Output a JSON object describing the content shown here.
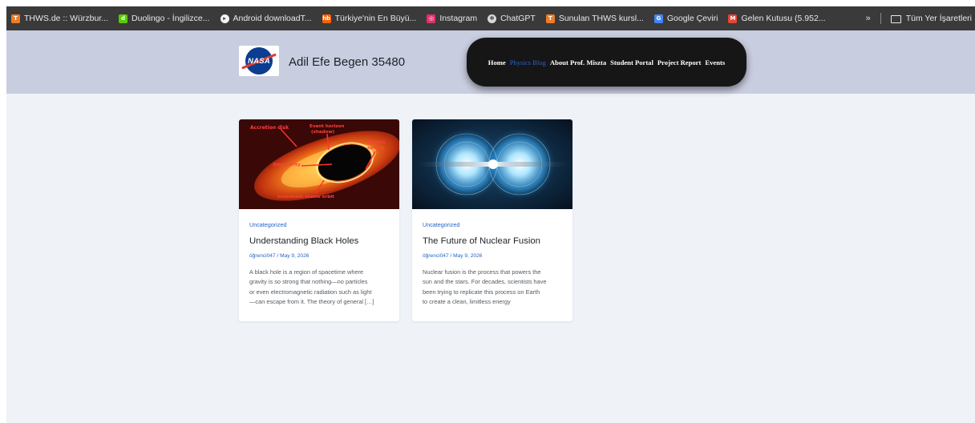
{
  "bookmarks": [
    {
      "label": "THWS.de :: Würzbur...",
      "icon": "thws-icon",
      "color": "#f07c24",
      "glyph": "T"
    },
    {
      "label": "Duolingo - İngilizce...",
      "icon": "duolingo-icon",
      "color": "#58cc02",
      "glyph": "d"
    },
    {
      "label": "Android downloadT...",
      "icon": "download-icon",
      "color": "#f2f2f2",
      "glyph": "▸"
    },
    {
      "label": "Türkiye'nin En Büyü...",
      "icon": "hb-icon",
      "color": "#ff6000",
      "glyph": "hb"
    },
    {
      "label": "Instagram",
      "icon": "instagram-icon",
      "color": "#e1306c",
      "glyph": "◎"
    },
    {
      "label": "ChatGPT",
      "icon": "chatgpt-icon",
      "color": "#d9d9d9",
      "glyph": "✻"
    },
    {
      "label": "Sunulan THWS kursl...",
      "icon": "thws-icon",
      "color": "#f07c24",
      "glyph": "T"
    },
    {
      "label": "Google Çeviri",
      "icon": "google-translate-icon",
      "color": "#4285f4",
      "glyph": "G"
    },
    {
      "label": "Gelen Kutusu (5.952...",
      "icon": "gmail-icon",
      "color": "#ea4335",
      "glyph": "M"
    }
  ],
  "bookmarks_more": "»",
  "all_bookmarks": "Tüm Yer İşaretleri",
  "site": {
    "title": "Adil Efe Begen 35480",
    "logo_text": "NASA"
  },
  "nav": {
    "items": [
      "Home",
      "Physics Blog",
      "About Prof. Miszta",
      "Student Portal",
      "Project Report",
      "Events"
    ],
    "active": "Physics Blog",
    "active_color": "#2a62c9"
  },
  "posts": [
    {
      "category": "Uncategorized",
      "title": "Understanding Black Holes",
      "meta": "öğrenci047 / May 9, 2026",
      "excerpt_lines": [
        "A black hole is a region of spacetime where",
        "gravity is so strong that nothing—no particles",
        "or even electromagnetic radiation such as light",
        "—can escape from it. The theory of general […]"
      ],
      "image_labels": [
        "Accretion disk",
        "Event horizon",
        "(shadow)",
        "Photon",
        "sphere",
        "Singularity",
        "Innermost stable orbit"
      ]
    },
    {
      "category": "Uncategorized",
      "title": "The Future of Nuclear Fusion",
      "meta": "öğrenci047 / May 9, 2026",
      "excerpt_lines": [
        "Nuclear fusion is the process that powers the",
        "sun and the stars. For decades, scientists have",
        "been trying to replicate this process on Earth",
        "to create a clean, limitless energy"
      ]
    }
  ],
  "colors": {
    "header_bg": "#c9cde0",
    "page_bg": "#eff3f8",
    "nav_bg": "#161616",
    "link": "#2563c9"
  }
}
